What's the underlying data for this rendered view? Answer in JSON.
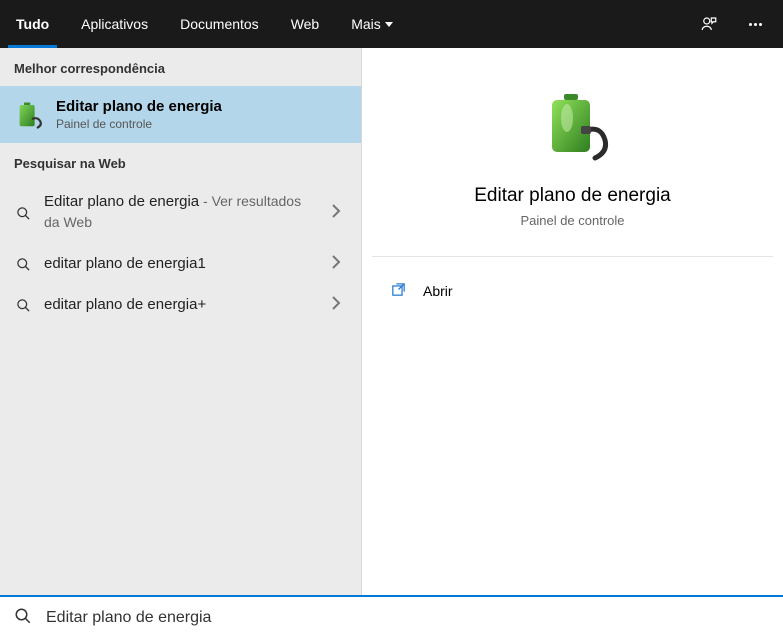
{
  "header": {
    "tabs": {
      "tudo": "Tudo",
      "aplicativos": "Aplicativos",
      "documentos": "Documentos",
      "web": "Web",
      "mais": "Mais"
    }
  },
  "left": {
    "best_match_header": "Melhor correspondência",
    "best_match": {
      "title": "Editar plano de energia",
      "subtitle": "Painel de controle"
    },
    "web_header": "Pesquisar na Web",
    "web_items": [
      {
        "label": "Editar plano de energia",
        "suffix": " - Ver resultados da Web"
      },
      {
        "label": "editar plano de energia1",
        "suffix": ""
      },
      {
        "label": "editar plano de energia+",
        "suffix": ""
      }
    ]
  },
  "detail": {
    "title": "Editar plano de energia",
    "subtitle": "Painel de controle",
    "actions": {
      "open": "Abrir"
    }
  },
  "search": {
    "value": "Editar plano de energia"
  }
}
